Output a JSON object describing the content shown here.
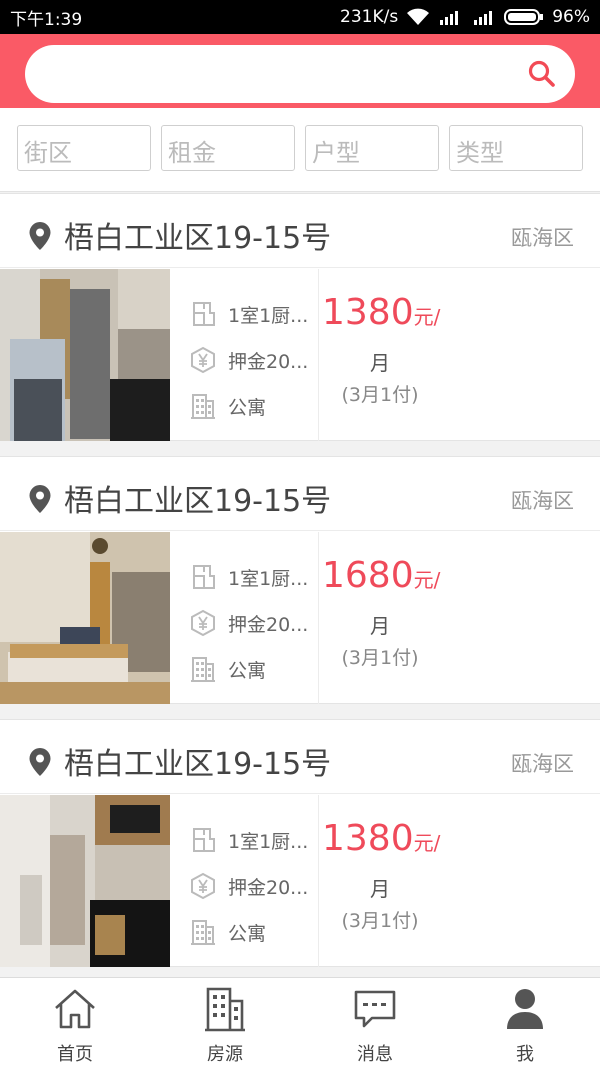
{
  "status_bar": {
    "time": "下午1:39",
    "net_speed": "231K/s",
    "battery": "96%",
    "network_badge": "4G\n1X"
  },
  "search": {
    "placeholder": "",
    "icon": "search-icon"
  },
  "filters": [
    {
      "label": "街区"
    },
    {
      "label": "租金"
    },
    {
      "label": "户型"
    },
    {
      "label": "类型"
    }
  ],
  "listings": [
    {
      "title": "梧白工业区19-15号",
      "district": "瓯海区",
      "layout": "1室1厨...",
      "deposit": "押金20...",
      "type": "公寓",
      "price": "1380",
      "price_unit": "元/",
      "price_month": "月",
      "payment_terms": "(3月1付)"
    },
    {
      "title": "梧白工业区19-15号",
      "district": "瓯海区",
      "layout": "1室1厨...",
      "deposit": "押金20...",
      "type": "公寓",
      "price": "1680",
      "price_unit": "元/",
      "price_month": "月",
      "payment_terms": "(3月1付)"
    },
    {
      "title": "梧白工业区19-15号",
      "district": "瓯海区",
      "layout": "1室1厨...",
      "deposit": "押金20...",
      "type": "公寓",
      "price": "1380",
      "price_unit": "元/",
      "price_month": "月",
      "payment_terms": "(3月1付)"
    }
  ],
  "tabs": [
    {
      "label": "首页",
      "icon": "home-icon"
    },
    {
      "label": "房源",
      "icon": "building-icon"
    },
    {
      "label": "消息",
      "icon": "message-icon"
    },
    {
      "label": "我",
      "icon": "user-icon"
    }
  ],
  "colors": {
    "accent": "#fa5a66",
    "price": "#ef4a5a",
    "status_bar": "#000000"
  }
}
